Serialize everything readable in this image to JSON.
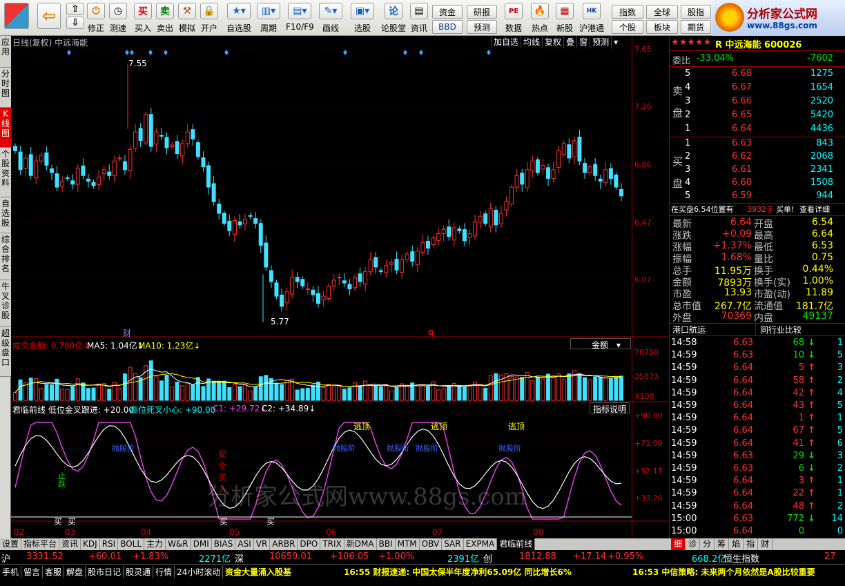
{
  "toolbar": {
    "big": [
      "买入",
      "卖出",
      "模拟",
      "开户",
      "自选股",
      "周期",
      "F10/F9",
      "画线",
      "选股",
      "论股堂",
      "资讯",
      "数据",
      "热点",
      "新股",
      "沪港通"
    ],
    "nav": [
      "修正",
      "测速"
    ],
    "small": [
      "资金",
      "BBD",
      "研报",
      "预测",
      "指数",
      "个股",
      "全球",
      "板块",
      "股指",
      "期货"
    ],
    "logo_title": "分析家公式网",
    "logo_url": "www.88gs.com"
  },
  "lefttabs": [
    "应用",
    "分时图",
    "K线图",
    "个股资料",
    "自选股",
    "综合排名",
    "牛叉诊股",
    "超级盘口"
  ],
  "main": {
    "title": "日线(复权) 中远海能",
    "buttons": [
      "加自选",
      "均线",
      "复权",
      "叠",
      "窗",
      "预测"
    ],
    "price_axis": [
      "7.65",
      "7.26",
      "6.86",
      "6.47",
      "6.07"
    ],
    "hi_label": "7.55",
    "lo_label": "5.77",
    "cai": "财",
    "q": "q",
    "vol_title": "成交金额: 0.789亿↓",
    "vol_ma5": "MA5: 1.04亿↓",
    "vol_ma10": "MA10: 1.23亿↓",
    "vol_select": "金额",
    "vol_axis": [
      "70750",
      "35873",
      "X100"
    ],
    "ind_title": "君临前线 低位金叉跟进: +20.00",
    "ind_hi": "高位死叉小心: +90.00",
    "ind_c1": "C1: +29.72↓",
    "ind_c2": "C2: +34.89↓",
    "ind_btn": "指标说明",
    "ind_axis": [
      "+90.00",
      "+71.09",
      "+52.17",
      "+33.26"
    ],
    "sig_escape": "逃顶",
    "sig_watch": "抛股阶",
    "sig_safe": "安全买入",
    "sig_stop": "止跌",
    "sig_buy": "买",
    "watermark": "分析家公式网www.88gs.com",
    "dates": [
      "02",
      "03",
      "04",
      "05",
      "06",
      "07",
      "08"
    ]
  },
  "chart_data": {
    "type": "candlestick",
    "stock": "中远海能",
    "ylim": [
      5.77,
      7.65
    ],
    "close": [
      6.95,
      6.82,
      6.9,
      6.78,
      6.88,
      6.92,
      6.85,
      6.8,
      6.7,
      6.74,
      6.76,
      6.72,
      6.83,
      6.78,
      6.74,
      6.71,
      6.77,
      6.82,
      6.78,
      6.88,
      6.9,
      6.82,
      6.96,
      7.08,
      7.02,
      7.2,
      6.98,
      7.08,
      7.05,
      6.97,
      6.99,
      6.93,
      7.0,
      7.08,
      7.03,
      6.91,
      6.84,
      6.7,
      6.6,
      6.52,
      6.45,
      6.4,
      6.47,
      6.44,
      6.48,
      6.5,
      6.45,
      6.3,
      6.15,
      6.05,
      5.95,
      5.88,
      5.98,
      6.08,
      6.05,
      6.02,
      6.0,
      5.96,
      5.9,
      5.95,
      6.02,
      6.06,
      6.08,
      6.04,
      6.0,
      6.08,
      6.05,
      6.12,
      6.2,
      6.15,
      6.12,
      6.16,
      6.18,
      6.13,
      6.2,
      6.24,
      6.19,
      6.26,
      6.32,
      6.28,
      6.35,
      6.38,
      6.41,
      6.36,
      6.42,
      6.4,
      6.33,
      6.38,
      6.46,
      6.5,
      6.45,
      6.55,
      6.44,
      6.52,
      6.6,
      6.7,
      6.78,
      6.72,
      6.82,
      6.88,
      6.8,
      6.85,
      6.76,
      6.82,
      6.95,
      7.0,
      6.9,
      7.02,
      6.88,
      6.8,
      6.84,
      6.78,
      6.74,
      6.82,
      6.76,
      6.7,
      6.64
    ],
    "vol_ma5": "1.04亿",
    "vol_ma10": "1.23亿",
    "vol_amount": "0.789亿"
  },
  "rp": {
    "stars": "★★★★★",
    "code": "R 中远海能 600026",
    "wb": "委比",
    "wb_pct": "-33.04%",
    "wb_diff": "-7602",
    "sell": [
      [
        "5",
        "6.68",
        "1275"
      ],
      [
        "4",
        "6.67",
        "1654"
      ],
      [
        "3",
        "6.66",
        "2520"
      ],
      [
        "2",
        "6.65",
        "5420"
      ],
      [
        "1",
        "6.64",
        "4436"
      ]
    ],
    "buy": [
      [
        "1",
        "6.63",
        "843"
      ],
      [
        "2",
        "6.62",
        "2068"
      ],
      [
        "3",
        "6.61",
        "2341"
      ],
      [
        "4",
        "6.60",
        "1508"
      ],
      [
        "5",
        "6.59",
        "944"
      ]
    ],
    "sell_label": "卖盘",
    "buy_label": "买盘",
    "notice": "在买盘6.54位置有",
    "notice_vol": "3932手",
    "notice_b": "买单!",
    "notice_link": "查看详细",
    "stats": [
      [
        "最新",
        "6.64",
        "开盘",
        "6.54"
      ],
      [
        "涨跌",
        "+0.09",
        "最高",
        "6.64"
      ],
      [
        "涨幅",
        "+1.37%",
        "最低",
        "6.53"
      ],
      [
        "振幅",
        "1.68%",
        "量比",
        "0.75"
      ],
      [
        "总手",
        "11.95万",
        "换手",
        "0.44%"
      ],
      [
        "金额",
        "7893万",
        "换手(实)",
        "1.00%"
      ],
      [
        "市盈",
        "13.93",
        "市盈(动)",
        "11.89"
      ],
      [
        "总市值",
        "267.7亿",
        "流通值",
        "181.7亿"
      ],
      [
        "外盘",
        "70369",
        "内盘",
        "49137"
      ]
    ],
    "tab1": "港口航运",
    "tab2": "同行业比较",
    "ticks": [
      [
        "14:58",
        "6.63",
        "68",
        "↓",
        "1"
      ],
      [
        "14:59",
        "6.63",
        "10",
        "↓",
        "5"
      ],
      [
        "14:59",
        "6.64",
        "5",
        "↑",
        "3"
      ],
      [
        "14:59",
        "6.64",
        "58",
        "↑",
        "2"
      ],
      [
        "14:59",
        "6.64",
        "42",
        "↑",
        "4"
      ],
      [
        "14:59",
        "6.64",
        "43",
        "↑",
        "5"
      ],
      [
        "14:59",
        "6.64",
        "1",
        "↑",
        "1"
      ],
      [
        "14:59",
        "6.64",
        "67",
        "↑",
        "5"
      ],
      [
        "14:59",
        "6.64",
        "41",
        "↑",
        "6"
      ],
      [
        "14:59",
        "6.63",
        "29",
        "↓",
        "3"
      ],
      [
        "14:59",
        "6.63",
        "6",
        "↓",
        "2"
      ],
      [
        "14:59",
        "6.64",
        "3",
        "↑",
        "1"
      ],
      [
        "14:59",
        "6.64",
        "22",
        "↑",
        "1"
      ],
      [
        "14:59",
        "6.64",
        "48",
        "↑",
        "2"
      ],
      [
        "15:00",
        "6.63",
        "772",
        "↓",
        "14"
      ],
      [
        "15:00",
        "6.64",
        "0",
        "",
        "0"
      ]
    ],
    "btabs": [
      "细",
      "诊",
      "分",
      "筹",
      "焰",
      "指",
      "财"
    ]
  },
  "btabs": [
    "设置",
    "指标平台",
    "资讯",
    "KDJ",
    "RSI",
    "BOLL",
    "主力",
    "W&R",
    "DMI",
    "BIAS",
    "ASI",
    "VR",
    "ARBR",
    "DPO",
    "TRIX",
    "新DMA",
    "BBI",
    "MTM",
    "OBV",
    "SAR",
    "EXPMA",
    "君临前线"
  ],
  "status": {
    "sh": "沪",
    "sh_val": "3331.52",
    "sh_chg": "+60.01",
    "sh_pct": "+1.83%",
    "sh_amt": "2271亿",
    "sz": "深",
    "sz_val": "10659.01",
    "sz_chg": "+106.05",
    "sz_pct": "+1.00%",
    "sz_amt": "2391亿",
    "cy": "创",
    "cy_val": "1812.88",
    "cy_chg": "+17.14",
    "cy_pct": "+0.95%",
    "hk_amt": "668.2亿",
    "hk": "恒生指数",
    "hk_val": "27"
  },
  "ticker": {
    "links": [
      "手机",
      "留言",
      "客服",
      "解盘",
      "股市日记",
      "股灵通",
      "行情",
      "24小时滚动"
    ],
    "news1": "资金大量涌入股基",
    "news2": "16:55 财报速递: 中国太保半年度净利65.09亿 同比增长6%",
    "news3": "16:53 中信策略: 未来两个月依然是A股比较重要"
  }
}
